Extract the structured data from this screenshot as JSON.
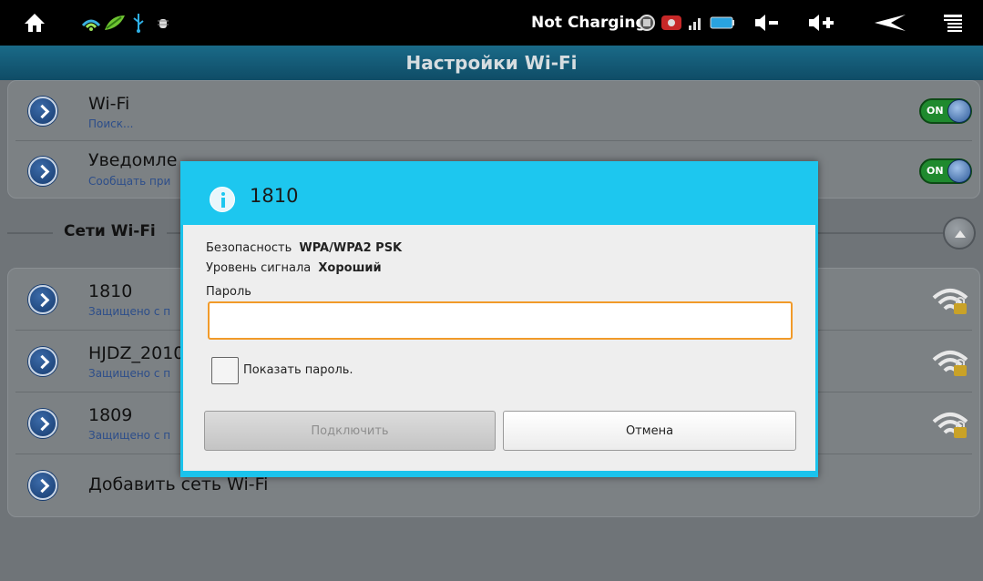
{
  "status_bar": {
    "charging_text": "Not Charging",
    "icons": [
      "home-icon",
      "wifi-signal-icon",
      "android-debug-icon",
      "usb-icon",
      "debug-bug-icon",
      "screenshot-icon",
      "record-icon",
      "cell-signal-icon",
      "battery-icon",
      "volume-down-icon",
      "volume-up-icon",
      "back-icon",
      "menu-icon"
    ]
  },
  "title_bar": {
    "title": "Настройки Wi-Fi"
  },
  "settings": {
    "wifi": {
      "title": "Wi-Fi",
      "subtitle": "Поиск...",
      "toggle": "ON"
    },
    "notify": {
      "title": "Уведомле",
      "subtitle": "Сообщать при",
      "toggle": "ON"
    }
  },
  "networks_section": {
    "label": "Сети Wi-Fi"
  },
  "networks": [
    {
      "name": "1810",
      "subtitle": "Защищено с п"
    },
    {
      "name": "HJDZ_2010",
      "subtitle": "Защищено с п"
    },
    {
      "name": "1809",
      "subtitle": "Защищено с п"
    }
  ],
  "add_network": {
    "label": "Добавить сеть Wi-Fi"
  },
  "dialog": {
    "title": "1810",
    "security_label": "Безопасность",
    "security_value": "WPA/WPA2 PSK",
    "signal_label": "Уровень сигнала",
    "signal_value": "Хороший",
    "password_label": "Пароль",
    "password_value": "",
    "show_password_label": "Показать пароль.",
    "show_password_checked": false,
    "connect_label": "Подключить",
    "cancel_label": "Отмена"
  },
  "colors": {
    "accent": "#1dc7ef",
    "input_focus": "#f19a29",
    "toggle_on": "#1f8a2e",
    "title_bar": "#0f4c66"
  }
}
